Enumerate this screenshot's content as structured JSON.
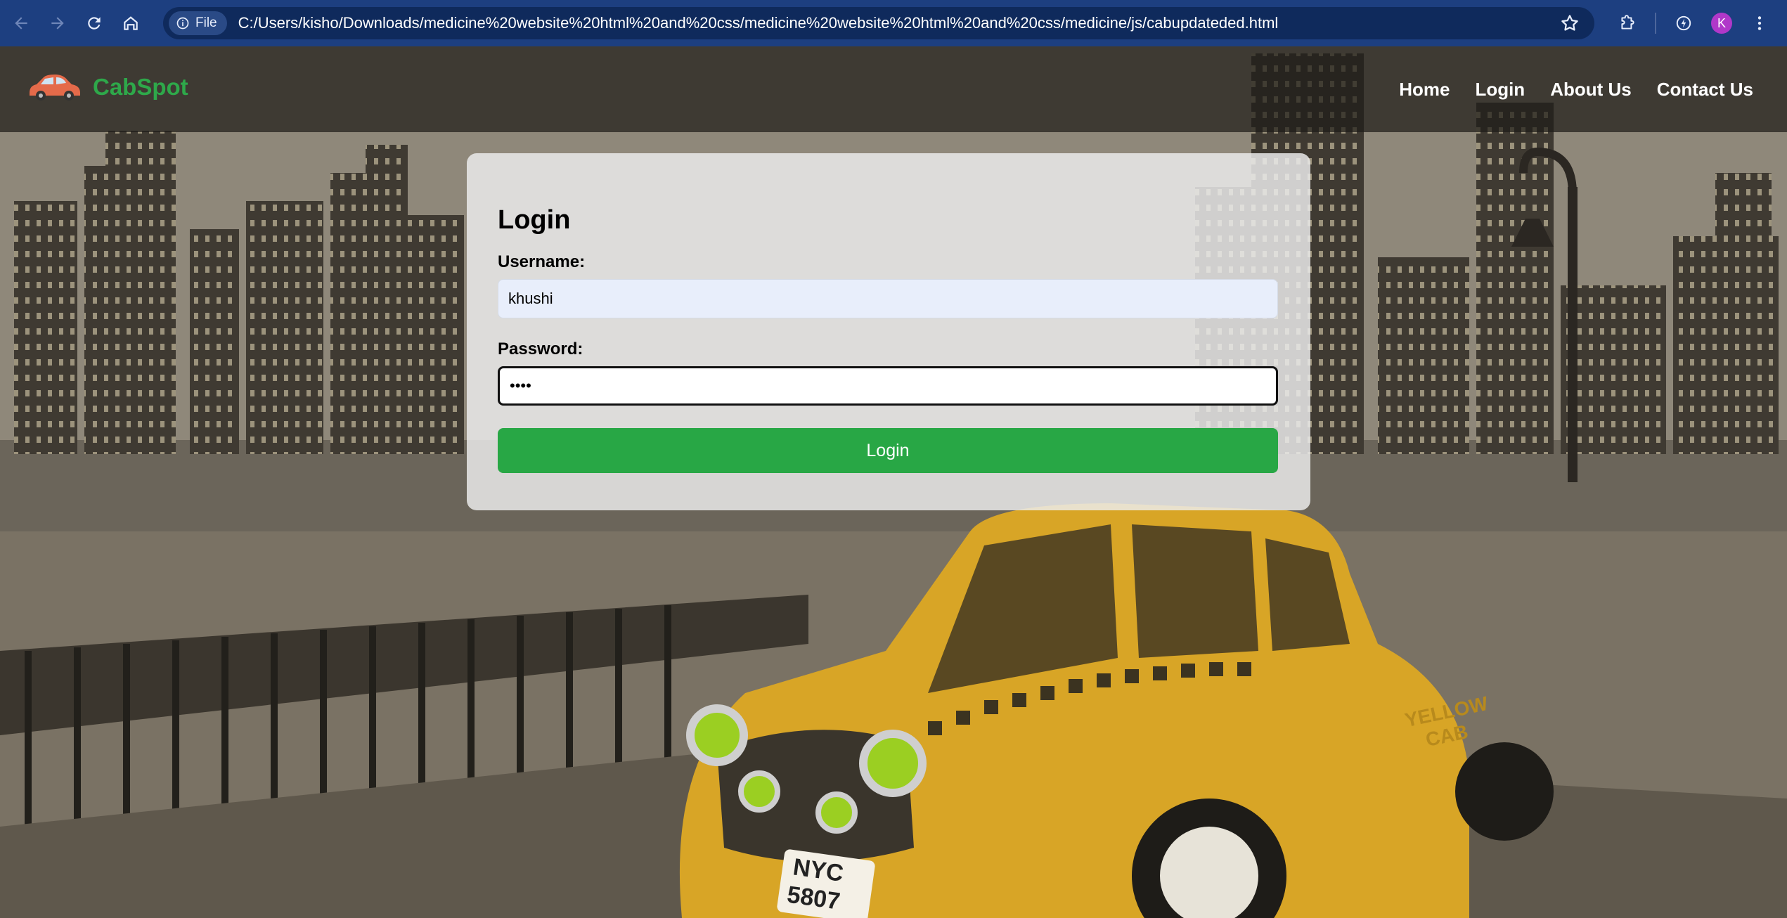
{
  "browser": {
    "site_chip_label": "File",
    "url": "C:/Users/kisho/Downloads/medicine%20website%20html%20and%20css/medicine%20website%20html%20and%20css/medicine/js/cabupdateded.html",
    "profile_initial": "K"
  },
  "navbar": {
    "brand": "CabSpot",
    "brand_color": "#2ea84a",
    "links": [
      {
        "label": "Home"
      },
      {
        "label": "Login"
      },
      {
        "label": "About Us"
      },
      {
        "label": "Contact Us"
      }
    ]
  },
  "login": {
    "title": "Login",
    "username_label": "Username:",
    "username_value": "khushi",
    "password_label": "Password:",
    "password_value": "khus",
    "button_label": "Login",
    "button_color": "#28a745"
  },
  "background": {
    "plate_line1": "NYC",
    "plate_line2": "5807",
    "cab_door_text_1": "YELLOW",
    "cab_door_text_2": "CAB"
  }
}
